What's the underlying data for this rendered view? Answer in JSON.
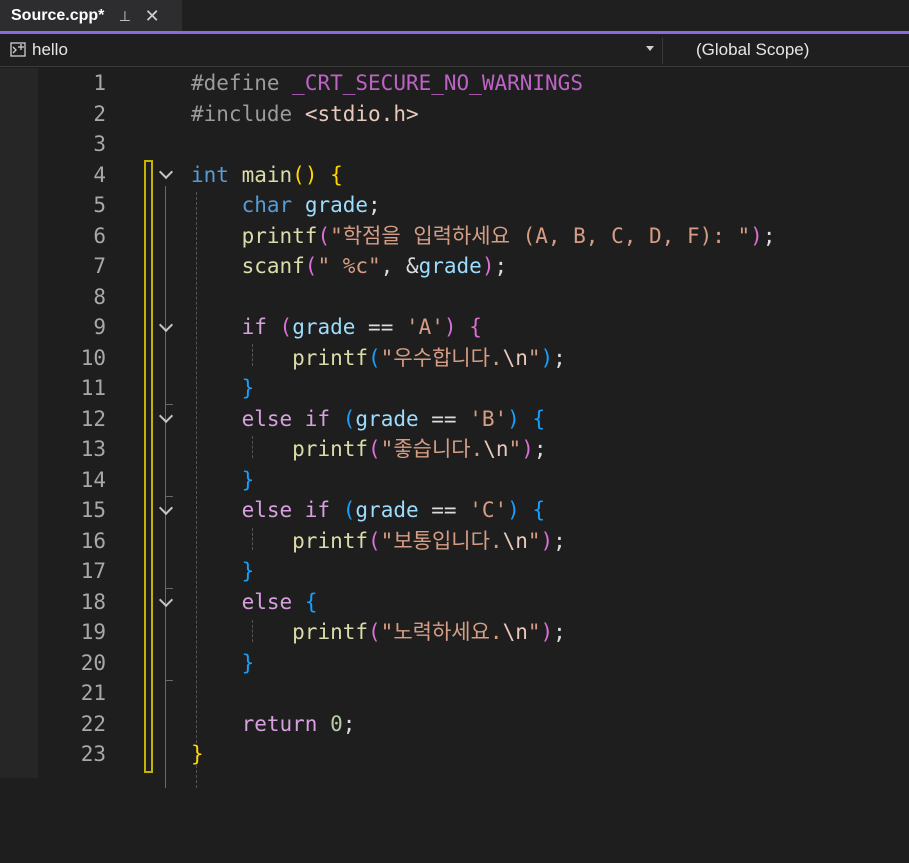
{
  "tab": {
    "title": "Source.cpp*",
    "pin_icon": "pin-icon",
    "close_icon": "close-icon",
    "close_glyph": "✕",
    "pin_glyph": "⊣"
  },
  "navbar": {
    "project": "hello",
    "scope": "(Global Scope)"
  },
  "editor": {
    "line_numbers": [
      "1",
      "2",
      "3",
      "4",
      "5",
      "6",
      "7",
      "8",
      "9",
      "10",
      "11",
      "12",
      "13",
      "14",
      "15",
      "16",
      "17",
      "18",
      "19",
      "20",
      "21",
      "22",
      "23"
    ],
    "folded_lines": [
      4,
      9,
      12,
      15,
      18
    ],
    "code": {
      "l1": {
        "directive": "#define",
        "macro": "_CRT_SECURE_NO_WARNINGS"
      },
      "l2": {
        "directive": "#include",
        "header": "<stdio.h>"
      },
      "l4": {
        "type": "int",
        "name": "main",
        "paren": "()",
        "brace": "{"
      },
      "l5": {
        "type": "char",
        "var": "grade",
        "semi": ";"
      },
      "l6": {
        "fn": "printf",
        "open": "(",
        "str": "\"학점을 입력하세요 (A, B, C, D, F): \"",
        "close": ")",
        "semi": ";"
      },
      "l7": {
        "fn": "scanf",
        "open": "(",
        "str": "\" %c\"",
        "comma": ", &",
        "var": "grade",
        "close": ")",
        "semi": ";"
      },
      "l9": {
        "kw": "if",
        "open": "(",
        "var": "grade",
        "op": " == ",
        "char": "'A'",
        "close": ")",
        "brace": "{"
      },
      "l10": {
        "fn": "printf",
        "open": "(",
        "str": "\"우수합니다.",
        "esc": "\\n",
        "str_end": "\"",
        "close": ")",
        "semi": ";"
      },
      "l11": {
        "brace": "}"
      },
      "l12": {
        "kw": "else if",
        "open": "(",
        "var": "grade",
        "op": " == ",
        "char": "'B'",
        "close": ")",
        "brace": "{"
      },
      "l13": {
        "fn": "printf",
        "open": "(",
        "str": "\"좋습니다.",
        "esc": "\\n",
        "str_end": "\"",
        "close": ")",
        "semi": ";"
      },
      "l14": {
        "brace": "}"
      },
      "l15": {
        "kw": "else if",
        "open": "(",
        "var": "grade",
        "op": " == ",
        "char": "'C'",
        "close": ")",
        "brace": "{"
      },
      "l16": {
        "fn": "printf",
        "open": "(",
        "str": "\"보통입니다.",
        "esc": "\\n",
        "str_end": "\"",
        "close": ")",
        "semi": ";"
      },
      "l17": {
        "brace": "}"
      },
      "l18": {
        "kw": "else",
        "brace": "{"
      },
      "l19": {
        "fn": "printf",
        "open": "(",
        "str": "\"노력하세요.",
        "esc": "\\n",
        "str_end": "\"",
        "close": ")",
        "semi": ";"
      },
      "l20": {
        "brace": "}"
      },
      "l22": {
        "kw": "return",
        "num": "0",
        "semi": ";"
      },
      "l23": {
        "brace": "}"
      }
    }
  },
  "colors": {
    "accent": "#8a6ce0",
    "change_bar": "#c6b200",
    "background": "#1e1e1e"
  }
}
